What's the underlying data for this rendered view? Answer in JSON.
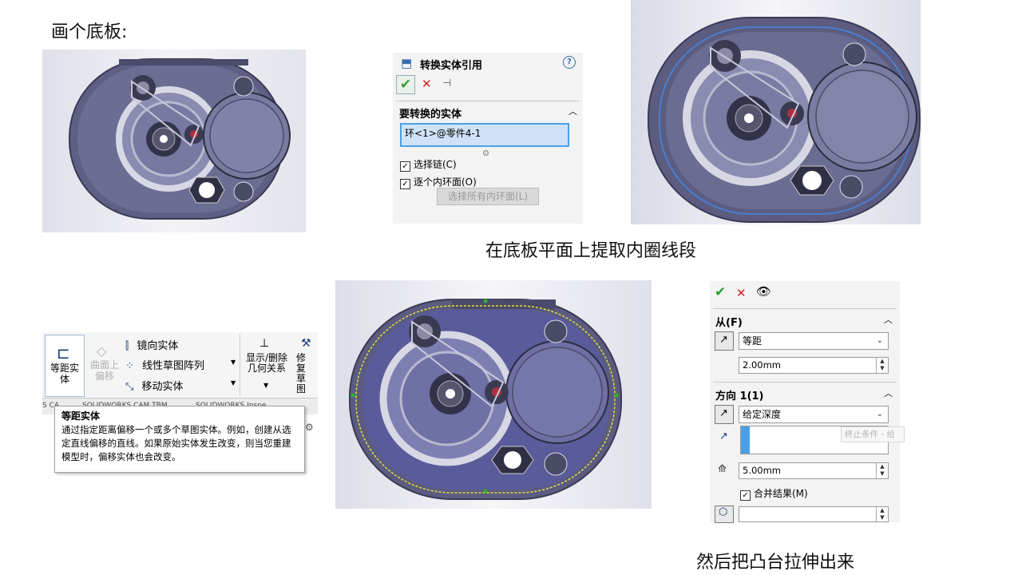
{
  "captions": {
    "top_left": "画个底板:",
    "middle": "在底板平面上提取内圈线段",
    "bottom_right": "然后把凸台拉伸出来"
  },
  "convert_panel": {
    "title": "转换实体引用",
    "help_icon": "?",
    "section_title": "要转换的实体",
    "selection_value": "环<1>@零件4-1",
    "options": [
      {
        "label": "选择链(C)",
        "checked": true
      },
      {
        "label": "逐个内环面(O)",
        "checked": true
      }
    ],
    "select_all_button": "选择所有内环面(L)"
  },
  "ribbon": {
    "offset_button": "等距实体",
    "surface_offset": "曲面上偏移",
    "items": [
      "镜向实体",
      "线性草图阵列",
      "移动实体"
    ],
    "show_delete": "显示/删除几何关系",
    "repair": "修复草图",
    "tabs": [
      "S CA",
      "SOLIDWORKS CAM TBM",
      "SOLIDWORKS Inspe"
    ]
  },
  "tooltip": {
    "title": "等距实体",
    "body": "通过指定距离偏移一个或多个草图实体。例如，创建从选定直线偏移的直线。如果原始实体发生改变，则当您重建模型时，偏移实体也会改变。"
  },
  "extrude_panel": {
    "from_label": "从(F)",
    "from_type": "等距",
    "from_distance": "2.00mm",
    "direction_label": "方向 1(1)",
    "end_condition": "给定深度",
    "end_condition_hint": "终止条件 - 给",
    "depth": "5.00mm",
    "merge_label": "合并结果(M)",
    "merge_checked": true
  },
  "colors": {
    "confirm_green": "#2e9e2e",
    "cancel_red": "#d42020",
    "selection_blue": "#4aa0e6",
    "plate_body": "#5b5c80",
    "plate_face": "#434568"
  }
}
